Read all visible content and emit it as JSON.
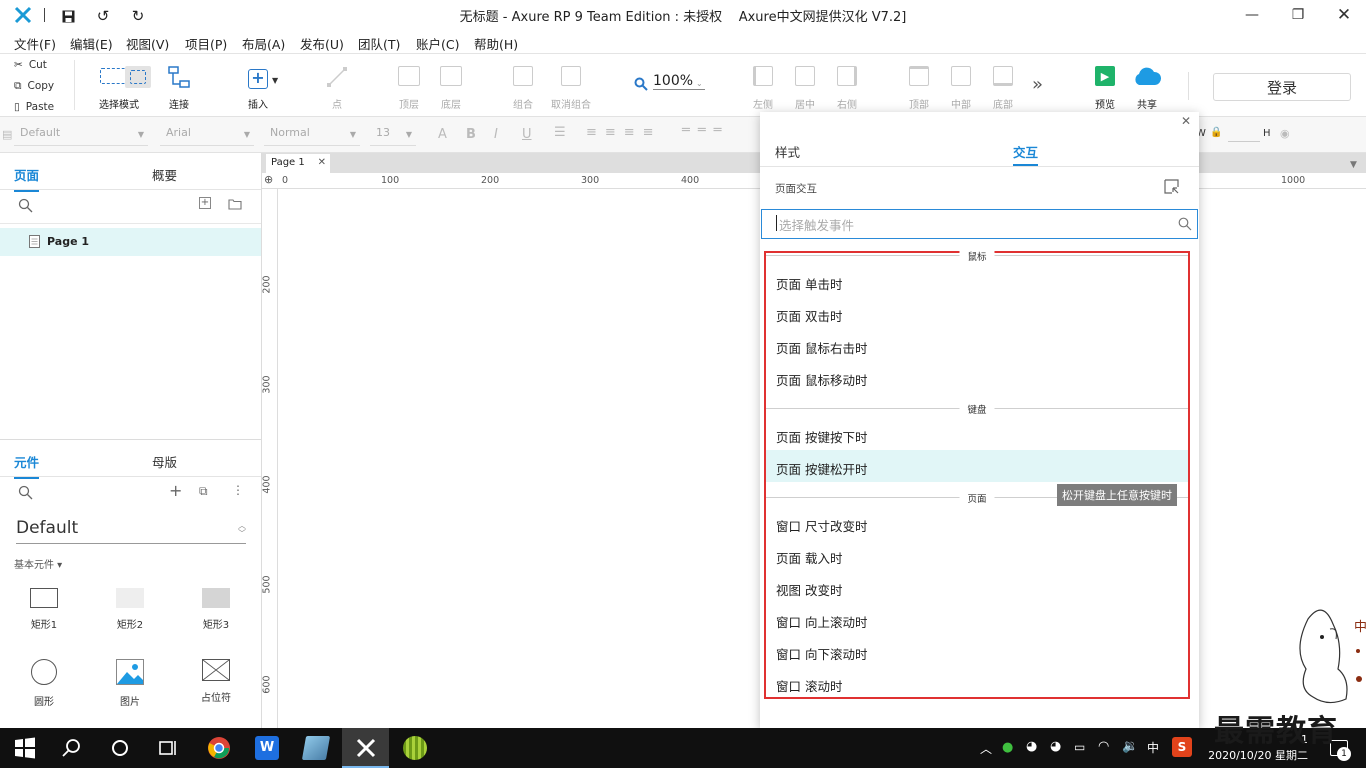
{
  "titlebar": {
    "title": "无标题 - Axure RP 9 Team Edition : 未授权",
    "subtitle": "Axure中文网提供汉化 V7.2]"
  },
  "menu": [
    "文件(F)",
    "编辑(E)",
    "视图(V)",
    "项目(P)",
    "布局(A)",
    "发布(U)",
    "团队(T)",
    "账户(C)",
    "帮助(H)"
  ],
  "clipboard": {
    "cut": "Cut",
    "copy": "Copy",
    "paste": "Paste"
  },
  "toolbar": {
    "select_mode": "选择模式",
    "connect": "连接",
    "insert": "插入",
    "point": "点",
    "top_layer": "顶层",
    "bottom_layer": "底层",
    "group": "组合",
    "ungroup": "取消组合",
    "zoom": "100%",
    "align_left": "左侧",
    "align_center": "居中",
    "align_right": "右侧",
    "align_top": "顶部",
    "align_middle": "中部",
    "align_bottom": "底部",
    "preview": "预览",
    "share": "共享",
    "login": "登录"
  },
  "stylebar": {
    "style": "Default",
    "font": "Arial",
    "weight": "Normal",
    "size": "13",
    "w_label": "W",
    "h_label": "H"
  },
  "pages_panel": {
    "tab_pages": "页面",
    "tab_outline": "概要",
    "page_item": "Page 1"
  },
  "widgets_panel": {
    "tab_widgets": "元件",
    "tab_masters": "母版",
    "library": "Default",
    "category": "基本元件 ▾",
    "items": [
      "矩形1",
      "矩形2",
      "矩形3",
      "圆形",
      "图片",
      "占位符"
    ]
  },
  "canvas": {
    "tab": "Page 1",
    "ruler_h": [
      "0",
      "100",
      "200",
      "300",
      "400",
      "1000"
    ],
    "ruler_v": [
      "200",
      "300",
      "400",
      "500",
      "600"
    ]
  },
  "interactions": {
    "tab_style": "样式",
    "tab_interact": "交互",
    "section_title": "页面交互",
    "search_placeholder": "选择触发事件",
    "groups": [
      {
        "title": "鼠标",
        "events": [
          "页面 单击时",
          "页面 双击时",
          "页面 鼠标右击时",
          "页面 鼠标移动时"
        ]
      },
      {
        "title": "键盘",
        "events": [
          "页面 按键按下时",
          "页面 按键松开时"
        ]
      },
      {
        "title": "页面",
        "events": [
          "窗口 尺寸改变时",
          "页面 载入时",
          "视图 改变时",
          "窗口 向上滚动时",
          "窗口 向下滚动时",
          "窗口 滚动时"
        ]
      }
    ],
    "tooltip": "松开键盘上任意按键时"
  },
  "taskbar": {
    "time": "1",
    "date": "2020/10/20 星期二",
    "ime": "中",
    "badge": "1"
  },
  "watermark": "最需教育",
  "colors": {
    "accent": "#1a87d6",
    "highlight": "#e1f6f7",
    "annotation_red": "#e03131"
  }
}
